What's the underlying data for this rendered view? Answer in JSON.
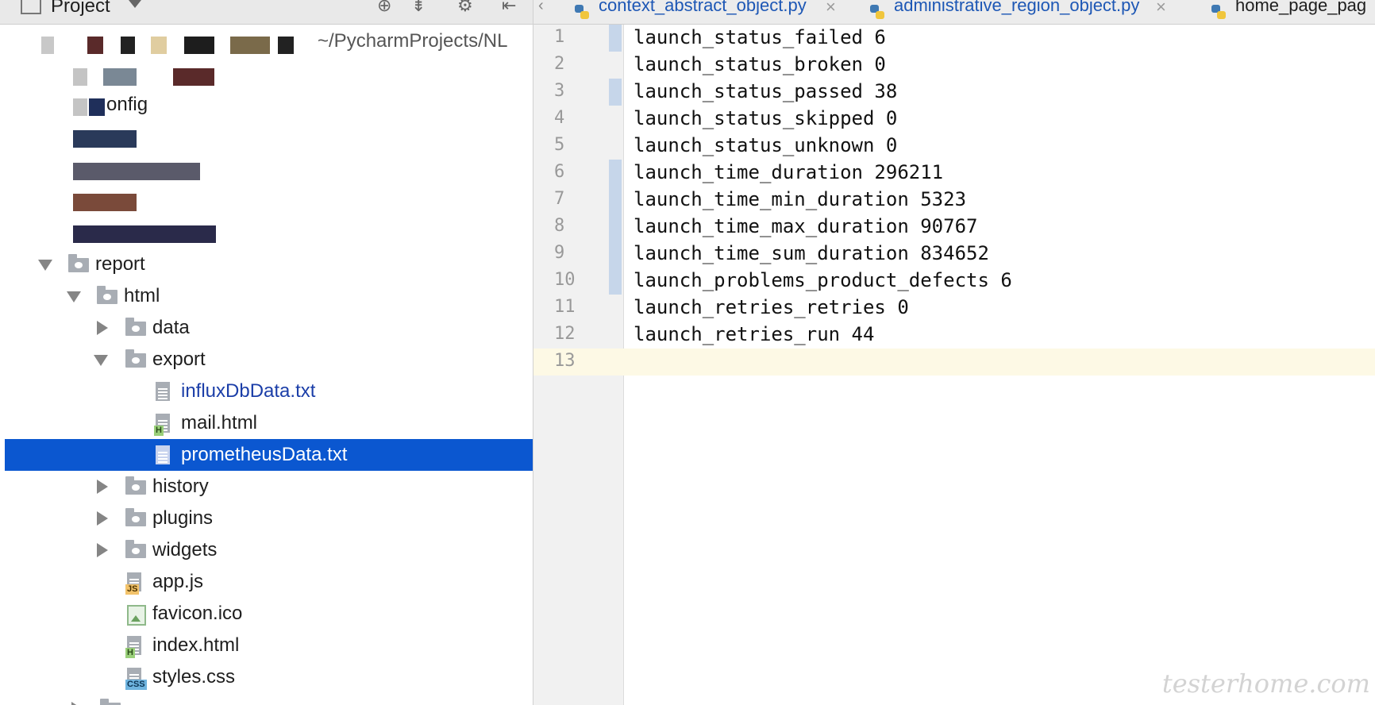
{
  "project": {
    "title": "Project",
    "path_fragment": "~/PycharmProjects/NL",
    "tree": [
      {
        "label": "onfig",
        "type": "partial",
        "blur": true
      },
      {
        "label": "report",
        "type": "folder",
        "expanded": true,
        "depth": 2
      },
      {
        "label": "html",
        "type": "folder",
        "expanded": true,
        "depth": 3
      },
      {
        "label": "data",
        "type": "folder",
        "expanded": false,
        "depth": 4
      },
      {
        "label": "export",
        "type": "folder",
        "expanded": true,
        "depth": 4
      },
      {
        "label": "influxDbData.txt",
        "type": "text",
        "depth": 5,
        "modified": true
      },
      {
        "label": "mail.html",
        "type": "html",
        "depth": 5
      },
      {
        "label": "prometheusData.txt",
        "type": "text",
        "depth": 5,
        "selected": true
      },
      {
        "label": "history",
        "type": "folder",
        "expanded": false,
        "depth": 4
      },
      {
        "label": "plugins",
        "type": "folder",
        "expanded": false,
        "depth": 4
      },
      {
        "label": "widgets",
        "type": "folder",
        "expanded": false,
        "depth": 4
      },
      {
        "label": "app.js",
        "type": "js",
        "depth": 4
      },
      {
        "label": "favicon.ico",
        "type": "image",
        "depth": 4
      },
      {
        "label": "index.html",
        "type": "html",
        "depth": 4
      },
      {
        "label": "styles.css",
        "type": "css",
        "depth": 4
      }
    ]
  },
  "tabs": [
    {
      "label": "context_abstract_object.py"
    },
    {
      "label": "administrative_region_object.py"
    },
    {
      "label": "home_page_pag"
    }
  ],
  "editor": {
    "lines": [
      {
        "num": "1",
        "text": "launch_status_failed 6",
        "changed": true
      },
      {
        "num": "2",
        "text": "launch_status_broken 0",
        "changed": false
      },
      {
        "num": "3",
        "text": "launch_status_passed 38",
        "changed": true
      },
      {
        "num": "4",
        "text": "launch_status_skipped 0",
        "changed": false
      },
      {
        "num": "5",
        "text": "launch_status_unknown 0",
        "changed": false
      },
      {
        "num": "6",
        "text": "launch_time_duration 296211",
        "changed": true
      },
      {
        "num": "7",
        "text": "launch_time_min_duration 5323",
        "changed": true
      },
      {
        "num": "8",
        "text": "launch_time_max_duration 90767",
        "changed": true
      },
      {
        "num": "9",
        "text": "launch_time_sum_duration 834652",
        "changed": true
      },
      {
        "num": "10",
        "text": "launch_problems_product_defects 6",
        "changed": true
      },
      {
        "num": "11",
        "text": "launch_retries_retries 0",
        "changed": false
      },
      {
        "num": "12",
        "text": "launch_retries_run 44",
        "changed": false
      },
      {
        "num": "13",
        "text": "",
        "changed": false,
        "current": true
      }
    ]
  },
  "watermark": "testerhome.com",
  "colors": {
    "selection": "#0b57d0",
    "current_line": "#fdf9e5",
    "change_marker": "#c6d6ea"
  }
}
